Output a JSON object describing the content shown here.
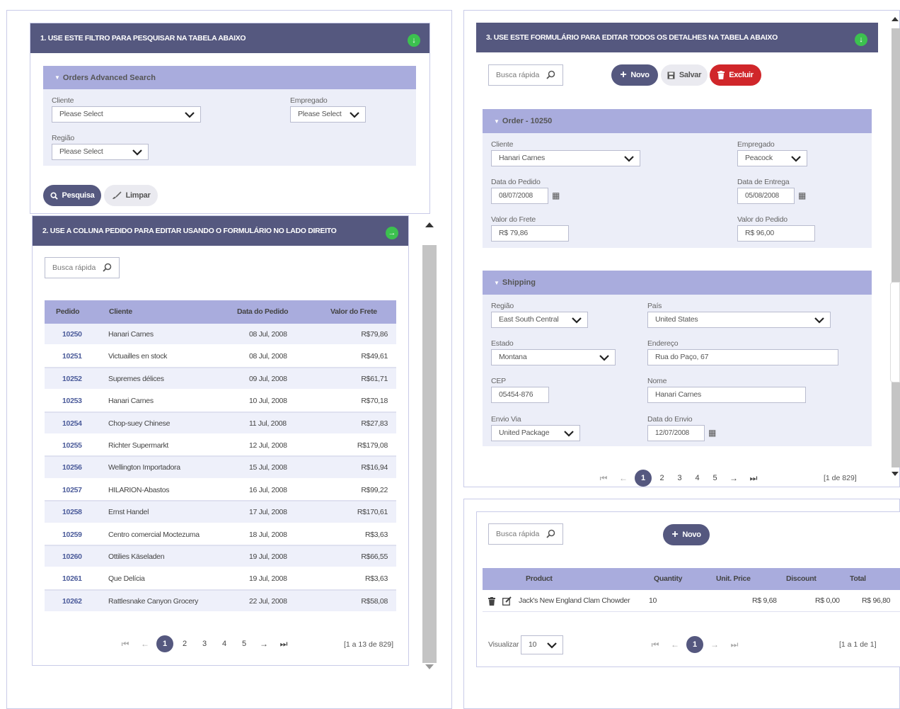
{
  "filter_panel": {
    "title": "1. USE ESTE FILTRO PARA PESQUISAR NA TABELA ABAIXO",
    "section_title": "Orders Advanced Search",
    "cliente_label": "Cliente",
    "cliente_value": "Please Select",
    "empregado_label": "Empregado",
    "empregado_value": "Please Select",
    "regiao_label": "Região",
    "regiao_value": "Please Select",
    "search_button": "Pesquisa",
    "clear_button": "Limpar"
  },
  "orders_panel": {
    "title": "2. USE A COLUNA PEDIDO PARA EDITAR USANDO O FORMULÁRIO NO LADO DIREITO",
    "search_placeholder": "Busca rápida",
    "columns": [
      "Pedido",
      "Cliente",
      "Data do Pedido",
      "Valor do Frete"
    ],
    "rows": [
      {
        "id": "10250",
        "cliente": "Hanari Carnes",
        "data": "08 Jul, 2008",
        "frete": "R$79,86"
      },
      {
        "id": "10251",
        "cliente": "Victuailles en stock",
        "data": "08 Jul, 2008",
        "frete": "R$49,61"
      },
      {
        "id": "10252",
        "cliente": "Supremes délices",
        "data": "09 Jul, 2008",
        "frete": "R$61,71"
      },
      {
        "id": "10253",
        "cliente": "Hanari Carnes",
        "data": "10 Jul, 2008",
        "frete": "R$70,18"
      },
      {
        "id": "10254",
        "cliente": "Chop-suey Chinese",
        "data": "11 Jul, 2008",
        "frete": "R$27,83"
      },
      {
        "id": "10255",
        "cliente": "Richter Supermarkt",
        "data": "12 Jul, 2008",
        "frete": "R$179,08"
      },
      {
        "id": "10256",
        "cliente": "Wellington Importadora",
        "data": "15 Jul, 2008",
        "frete": "R$16,94"
      },
      {
        "id": "10257",
        "cliente": "HILARION-Abastos",
        "data": "16 Jul, 2008",
        "frete": "R$99,22"
      },
      {
        "id": "10258",
        "cliente": "Ernst Handel",
        "data": "17 Jul, 2008",
        "frete": "R$170,61"
      },
      {
        "id": "10259",
        "cliente": "Centro comercial Moctezuma",
        "data": "18 Jul, 2008",
        "frete": "R$3,63"
      },
      {
        "id": "10260",
        "cliente": "Ottilies Käseladen",
        "data": "19 Jul, 2008",
        "frete": "R$66,55"
      },
      {
        "id": "10261",
        "cliente": "Que Delícia",
        "data": "19 Jul, 2008",
        "frete": "R$3,63"
      },
      {
        "id": "10262",
        "cliente": "Rattlesnake Canyon Grocery",
        "data": "22 Jul, 2008",
        "frete": "R$58,08"
      }
    ],
    "pages": [
      "1",
      "2",
      "3",
      "4",
      "5"
    ],
    "page_info": "[1 a 13 de 829]"
  },
  "edit_panel": {
    "title": "3. USE ESTE FORMULÁRIO PARA EDITAR TODOS OS DETALHES NA TABELA ABAIXO",
    "search_placeholder": "Busca rápida",
    "new_button": "Novo",
    "save_button": "Salvar",
    "delete_button": "Excluir",
    "order_section": "Order - 10250",
    "cliente_label": "Cliente",
    "cliente_value": "Hanari Carnes",
    "empregado_label": "Empregado",
    "empregado_value": "Peacock",
    "data_pedido_label": "Data do Pedido",
    "data_pedido_value": "08/07/2008",
    "data_entrega_label": "Data de Entrega",
    "data_entrega_value": "05/08/2008",
    "valor_frete_label": "Valor do Frete",
    "valor_frete_value": "R$ 79,86",
    "valor_pedido_label": "Valor do Pedido",
    "valor_pedido_value": "R$ 96,00",
    "shipping_section": "Shipping",
    "regiao_label": "Região",
    "regiao_value": "East South Central",
    "pais_label": "País",
    "pais_value": "United States",
    "estado_label": "Estado",
    "estado_value": "Montana",
    "endereco_label": "Endereço",
    "endereco_value": "Rua do Paço, 67",
    "cep_label": "CEP",
    "cep_value": "05454-876",
    "nome_label": "Nome",
    "nome_value": "Hanari Carnes",
    "envio_label": "Envio Via",
    "envio_value": "United Package",
    "data_envio_label": "Data do Envio",
    "data_envio_value": "12/07/2008",
    "pages": [
      "1",
      "2",
      "3",
      "4",
      "5"
    ],
    "page_info": "[1 de 829]"
  },
  "detail_panel": {
    "search_placeholder": "Busca rápida",
    "new_button": "Novo",
    "columns": [
      "Product",
      "Quantity",
      "Unit. Price",
      "Discount",
      "Total"
    ],
    "rows": [
      {
        "product": "Jack's New England Clam Chowder",
        "quantity": "10",
        "unit_price": "R$ 9,68",
        "discount": "R$ 0,00",
        "total": "R$ 96,80"
      }
    ],
    "view_label": "Visualizar",
    "view_value": "10",
    "pages": [
      "1"
    ],
    "page_info": "[1 a 1 de 1]"
  },
  "colors": {
    "header": "#55587f",
    "section": "#a9acdd",
    "section_body": "#eceef8",
    "accent_green": "#3cc14f",
    "delete_red": "#d0262a"
  }
}
